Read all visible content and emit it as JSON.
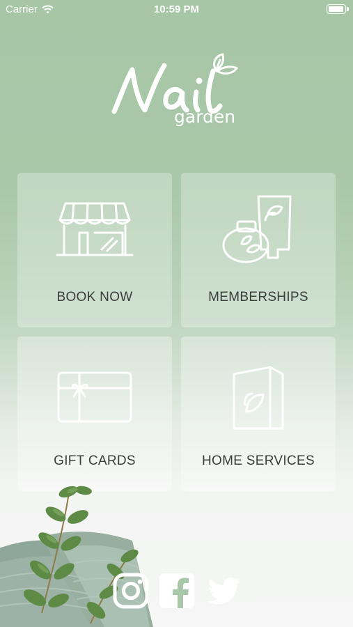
{
  "status_bar": {
    "carrier": "Carrier",
    "time": "10:59 PM",
    "battery_level": 1.0
  },
  "logo": {
    "brand_line1": "Nail",
    "brand_line2": "garden"
  },
  "tiles": [
    {
      "label": "BOOK NOW",
      "icon": "storefront-icon"
    },
    {
      "label": "MEMBERSHIPS",
      "icon": "cosmetics-icon"
    },
    {
      "label": "GIFT CARDS",
      "icon": "gift-card-icon"
    },
    {
      "label": "HOME SERVICES",
      "icon": "brochure-icon"
    }
  ],
  "social": [
    {
      "icon": "instagram-icon"
    },
    {
      "icon": "facebook-icon"
    },
    {
      "icon": "twitter-icon"
    }
  ],
  "colors": {
    "background_top": "#a6c6a6",
    "background_bottom": "#f5f6f5",
    "tile_label": "#3b3f3b",
    "icon_stroke": "#ffffff"
  }
}
